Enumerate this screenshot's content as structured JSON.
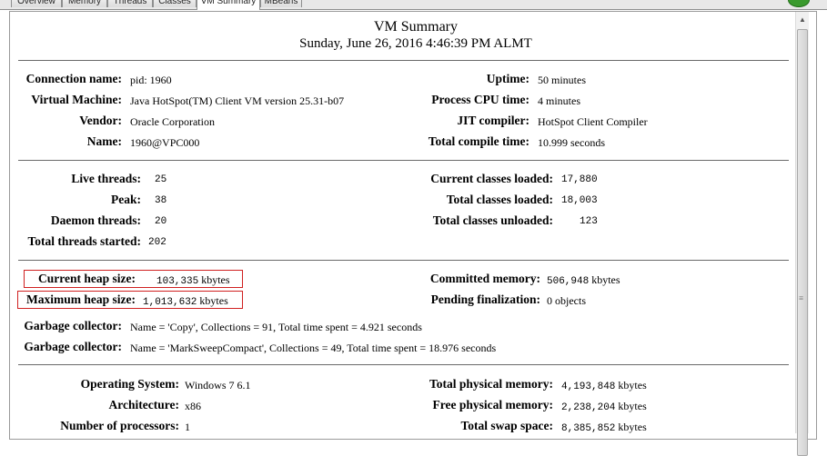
{
  "tabs": [
    "Overview",
    "Memory",
    "Threads",
    "Classes",
    "VM Summary",
    "MBeans"
  ],
  "active_tab": "VM Summary",
  "header": {
    "title": "VM Summary",
    "datetime": "Sunday, June 26, 2016 4:46:39 PM ALMT"
  },
  "vm_info": {
    "connection_name": {
      "label": "Connection name:",
      "value": "pid: 1960"
    },
    "virtual_machine": {
      "label": "Virtual Machine:",
      "value": "Java HotSpot(TM) Client VM version 25.31-b07"
    },
    "vendor": {
      "label": "Vendor:",
      "value": "Oracle Corporation"
    },
    "name": {
      "label": "Name:",
      "value": "1960@VPC000"
    },
    "uptime": {
      "label": "Uptime:",
      "value": "50 minutes"
    },
    "process_cpu_time": {
      "label": "Process CPU time:",
      "value": "4 minutes"
    },
    "jit_compiler": {
      "label": "JIT compiler:",
      "value": "HotSpot Client Compiler"
    },
    "total_compile_time": {
      "label": "Total compile time:",
      "value": "10.999 seconds"
    }
  },
  "threads": {
    "live": {
      "label": "Live threads:",
      "value": "25"
    },
    "peak": {
      "label": "Peak:",
      "value": "38"
    },
    "daemon": {
      "label": "Daemon threads:",
      "value": "20"
    },
    "total_started": {
      "label": "Total threads started:",
      "value": "202"
    }
  },
  "classes": {
    "current_loaded": {
      "label": "Current classes loaded:",
      "value": "17,880"
    },
    "total_loaded": {
      "label": "Total classes loaded:",
      "value": "18,003"
    },
    "total_unloaded": {
      "label": "Total classes unloaded:",
      "value": "123"
    }
  },
  "memory": {
    "current_heap": {
      "label": "Current heap size:",
      "value": "103,335",
      "unit": "kbytes"
    },
    "maximum_heap": {
      "label": "Maximum heap size:",
      "value": "1,013,632",
      "unit": "kbytes"
    },
    "committed": {
      "label": "Committed memory:",
      "value": "506,948",
      "unit": "kbytes"
    },
    "pending_finalization": {
      "label": "Pending finalization:",
      "value": "0 objects"
    },
    "gc1": {
      "label": "Garbage collector:",
      "value": "Name = 'Copy', Collections = 91, Total time spent = 4.921 seconds"
    },
    "gc2": {
      "label": "Garbage collector:",
      "value": "Name = 'MarkSweepCompact', Collections = 49, Total time spent = 18.976 seconds"
    }
  },
  "system": {
    "os": {
      "label": "Operating System:",
      "value": "Windows 7 6.1"
    },
    "arch": {
      "label": "Architecture:",
      "value": "x86"
    },
    "processors": {
      "label": "Number of processors:",
      "value": "1"
    },
    "total_physical": {
      "label": "Total physical memory:",
      "value": "4,193,848",
      "unit": "kbytes"
    },
    "free_physical": {
      "label": "Free physical memory:",
      "value": "2,238,204",
      "unit": "kbytes"
    },
    "total_swap": {
      "label": "Total swap space:",
      "value": "8,385,852",
      "unit": "kbytes"
    }
  },
  "colors": {
    "highlight_border": "#d02020",
    "divider": "#6a6a6a"
  }
}
